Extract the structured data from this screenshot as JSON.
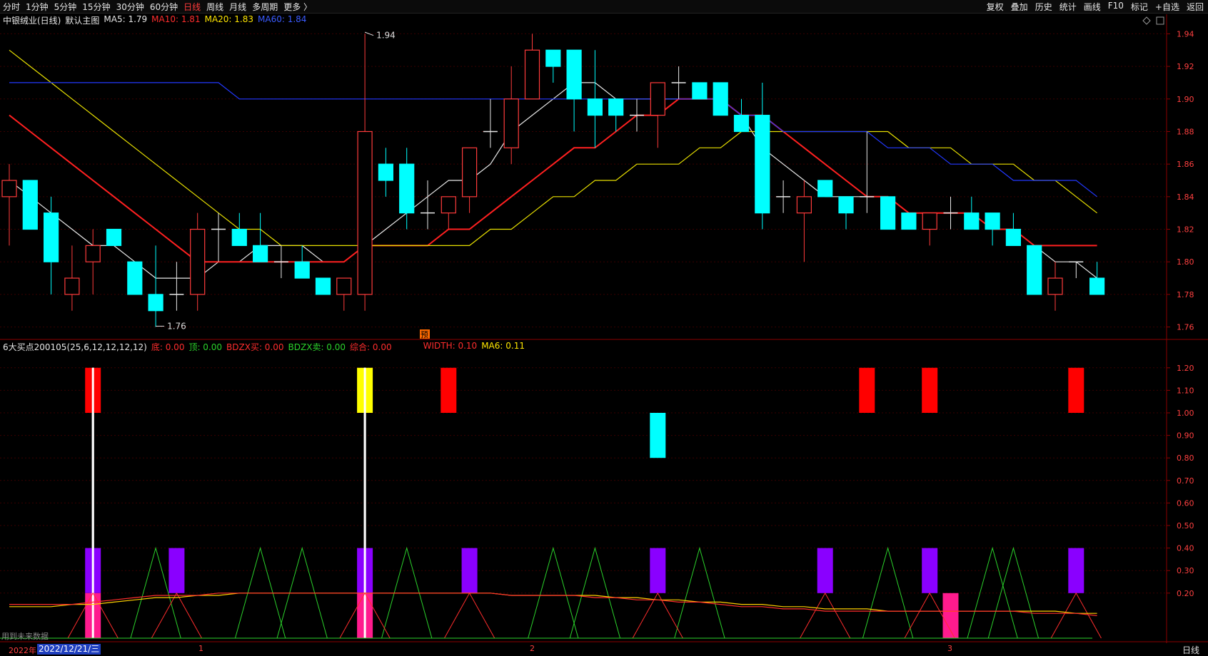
{
  "toolbar": {
    "left": [
      "分时",
      "1分钟",
      "5分钟",
      "15分钟",
      "30分钟",
      "60分钟",
      "日线",
      "周线",
      "月线",
      "多周期",
      "更多 〉"
    ],
    "active_index": 6,
    "right": [
      "复权",
      "叠加",
      "历史",
      "统计",
      "画线",
      "F10",
      "标记",
      "+自选",
      "返回"
    ]
  },
  "price_panel": {
    "stock_name": "中银绒业(日线)",
    "template": "默认主图",
    "ma5": "MA5: 1.79",
    "ma10": "MA10: 1.81",
    "ma20": "MA20: 1.83",
    "ma60": "MA60: 1.84",
    "high_marker": "1.94",
    "low_marker": "1.76",
    "axis": [
      "1.94",
      "1.92",
      "1.90",
      "1.88",
      "1.86",
      "1.84",
      "1.82",
      "1.80",
      "1.78",
      "1.76"
    ],
    "badge": "预"
  },
  "indicator_panel": {
    "name": "6大买点200105(25,6,12,12,12,12)",
    "di": "底: 0.00",
    "ding": "顶: 0.00",
    "bdzx_buy": "BDZX买: 0.00",
    "bdzx_sell": "BDZX卖: 0.00",
    "hehe": "综合: 0.00",
    "width": "WIDTH: 0.10",
    "ma6": "MA6: 0.11",
    "axis": [
      "1.20",
      "1.10",
      "1.00",
      "0.90",
      "0.80",
      "0.70",
      "0.60",
      "0.50",
      "0.40",
      "0.30",
      "0.20"
    ]
  },
  "footer": {
    "future_note": "用到未来数据",
    "year": "2022年",
    "date": "2022/12/21/三",
    "ticks": [
      "1",
      "2",
      "3"
    ],
    "period": "日线"
  },
  "chart_data": {
    "type": "candlestick",
    "candles": [
      {
        "o": 1.84,
        "h": 1.86,
        "l": 1.81,
        "c": 1.85
      },
      {
        "o": 1.85,
        "h": 1.85,
        "l": 1.82,
        "c": 1.82
      },
      {
        "o": 1.83,
        "h": 1.84,
        "l": 1.78,
        "c": 1.8
      },
      {
        "o": 1.78,
        "h": 1.81,
        "l": 1.77,
        "c": 1.79
      },
      {
        "o": 1.8,
        "h": 1.82,
        "l": 1.78,
        "c": 1.81
      },
      {
        "o": 1.82,
        "h": 1.82,
        "l": 1.81,
        "c": 1.81
      },
      {
        "o": 1.8,
        "h": 1.8,
        "l": 1.78,
        "c": 1.78
      },
      {
        "o": 1.78,
        "h": 1.81,
        "l": 1.76,
        "c": 1.77
      },
      {
        "o": 1.78,
        "h": 1.8,
        "l": 1.77,
        "c": 1.78
      },
      {
        "o": 1.78,
        "h": 1.83,
        "l": 1.77,
        "c": 1.82
      },
      {
        "o": 1.82,
        "h": 1.83,
        "l": 1.8,
        "c": 1.82
      },
      {
        "o": 1.82,
        "h": 1.83,
        "l": 1.81,
        "c": 1.81
      },
      {
        "o": 1.81,
        "h": 1.83,
        "l": 1.8,
        "c": 1.8
      },
      {
        "o": 1.8,
        "h": 1.81,
        "l": 1.79,
        "c": 1.8
      },
      {
        "o": 1.8,
        "h": 1.81,
        "l": 1.79,
        "c": 1.79
      },
      {
        "o": 1.79,
        "h": 1.79,
        "l": 1.78,
        "c": 1.78
      },
      {
        "o": 1.78,
        "h": 1.79,
        "l": 1.77,
        "c": 1.79
      },
      {
        "o": 1.78,
        "h": 1.94,
        "l": 1.77,
        "c": 1.88
      },
      {
        "o": 1.86,
        "h": 1.87,
        "l": 1.84,
        "c": 1.85
      },
      {
        "o": 1.86,
        "h": 1.87,
        "l": 1.82,
        "c": 1.83
      },
      {
        "o": 1.83,
        "h": 1.85,
        "l": 1.82,
        "c": 1.83
      },
      {
        "o": 1.83,
        "h": 1.84,
        "l": 1.82,
        "c": 1.84
      },
      {
        "o": 1.84,
        "h": 1.87,
        "l": 1.83,
        "c": 1.87
      },
      {
        "o": 1.88,
        "h": 1.9,
        "l": 1.87,
        "c": 1.88
      },
      {
        "o": 1.87,
        "h": 1.92,
        "l": 1.86,
        "c": 1.9
      },
      {
        "o": 1.9,
        "h": 1.94,
        "l": 1.9,
        "c": 1.93
      },
      {
        "o": 1.93,
        "h": 1.93,
        "l": 1.91,
        "c": 1.92
      },
      {
        "o": 1.93,
        "h": 1.93,
        "l": 1.88,
        "c": 1.9
      },
      {
        "o": 1.9,
        "h": 1.93,
        "l": 1.87,
        "c": 1.89
      },
      {
        "o": 1.9,
        "h": 1.9,
        "l": 1.88,
        "c": 1.89
      },
      {
        "o": 1.89,
        "h": 1.9,
        "l": 1.88,
        "c": 1.89
      },
      {
        "o": 1.89,
        "h": 1.91,
        "l": 1.87,
        "c": 1.91
      },
      {
        "o": 1.91,
        "h": 1.92,
        "l": 1.9,
        "c": 1.91
      },
      {
        "o": 1.91,
        "h": 1.91,
        "l": 1.9,
        "c": 1.9
      },
      {
        "o": 1.91,
        "h": 1.91,
        "l": 1.89,
        "c": 1.89
      },
      {
        "o": 1.89,
        "h": 1.9,
        "l": 1.88,
        "c": 1.88
      },
      {
        "o": 1.89,
        "h": 1.91,
        "l": 1.82,
        "c": 1.83
      },
      {
        "o": 1.84,
        "h": 1.85,
        "l": 1.83,
        "c": 1.84
      },
      {
        "o": 1.83,
        "h": 1.85,
        "l": 1.8,
        "c": 1.84
      },
      {
        "o": 1.85,
        "h": 1.85,
        "l": 1.84,
        "c": 1.84
      },
      {
        "o": 1.84,
        "h": 1.84,
        "l": 1.82,
        "c": 1.83
      },
      {
        "o": 1.84,
        "h": 1.88,
        "l": 1.83,
        "c": 1.84
      },
      {
        "o": 1.84,
        "h": 1.84,
        "l": 1.82,
        "c": 1.82
      },
      {
        "o": 1.83,
        "h": 1.83,
        "l": 1.82,
        "c": 1.82
      },
      {
        "o": 1.82,
        "h": 1.83,
        "l": 1.81,
        "c": 1.83
      },
      {
        "o": 1.83,
        "h": 1.84,
        "l": 1.82,
        "c": 1.83
      },
      {
        "o": 1.83,
        "h": 1.84,
        "l": 1.82,
        "c": 1.82
      },
      {
        "o": 1.83,
        "h": 1.83,
        "l": 1.81,
        "c": 1.82
      },
      {
        "o": 1.82,
        "h": 1.83,
        "l": 1.81,
        "c": 1.81
      },
      {
        "o": 1.81,
        "h": 1.81,
        "l": 1.78,
        "c": 1.78
      },
      {
        "o": 1.78,
        "h": 1.8,
        "l": 1.77,
        "c": 1.79
      },
      {
        "o": 1.8,
        "h": 1.8,
        "l": 1.79,
        "c": 1.8
      },
      {
        "o": 1.79,
        "h": 1.8,
        "l": 1.78,
        "c": 1.78
      }
    ],
    "ma_series": [
      {
        "name": "MA5",
        "color": "#e8e8e8",
        "values": [
          1.85,
          1.84,
          1.83,
          1.82,
          1.81,
          1.81,
          1.8,
          1.79,
          1.79,
          1.79,
          1.8,
          1.8,
          1.81,
          1.81,
          1.81,
          1.8,
          1.8,
          1.81,
          1.82,
          1.83,
          1.84,
          1.85,
          1.85,
          1.86,
          1.88,
          1.89,
          1.9,
          1.91,
          1.91,
          1.9,
          1.9,
          1.9,
          1.9,
          1.9,
          1.9,
          1.89,
          1.87,
          1.86,
          1.85,
          1.84,
          1.84,
          1.84,
          1.84,
          1.83,
          1.83,
          1.83,
          1.83,
          1.82,
          1.82,
          1.81,
          1.8,
          1.8,
          1.79
        ]
      },
      {
        "name": "MA10",
        "color": "#ff2020",
        "values": [
          1.89,
          1.88,
          1.87,
          1.86,
          1.85,
          1.84,
          1.83,
          1.82,
          1.81,
          1.8,
          1.8,
          1.8,
          1.8,
          1.8,
          1.8,
          1.8,
          1.8,
          1.81,
          1.81,
          1.81,
          1.81,
          1.82,
          1.82,
          1.83,
          1.84,
          1.85,
          1.86,
          1.87,
          1.87,
          1.88,
          1.89,
          1.89,
          1.9,
          1.9,
          1.9,
          1.89,
          1.89,
          1.88,
          1.87,
          1.86,
          1.85,
          1.84,
          1.84,
          1.83,
          1.83,
          1.83,
          1.83,
          1.82,
          1.82,
          1.81,
          1.81,
          1.81,
          1.81
        ]
      },
      {
        "name": "MA20",
        "color": "#e8e000",
        "values": [
          1.93,
          1.92,
          1.91,
          1.9,
          1.89,
          1.88,
          1.87,
          1.86,
          1.85,
          1.84,
          1.83,
          1.82,
          1.82,
          1.81,
          1.81,
          1.81,
          1.81,
          1.81,
          1.81,
          1.81,
          1.81,
          1.81,
          1.81,
          1.82,
          1.82,
          1.83,
          1.84,
          1.84,
          1.85,
          1.85,
          1.86,
          1.86,
          1.86,
          1.87,
          1.87,
          1.88,
          1.88,
          1.88,
          1.88,
          1.88,
          1.88,
          1.88,
          1.88,
          1.87,
          1.87,
          1.87,
          1.86,
          1.86,
          1.86,
          1.85,
          1.85,
          1.84,
          1.83
        ]
      },
      {
        "name": "MA60",
        "color": "#2238ff",
        "values": [
          1.91,
          1.91,
          1.91,
          1.91,
          1.91,
          1.91,
          1.91,
          1.91,
          1.91,
          1.91,
          1.91,
          1.9,
          1.9,
          1.9,
          1.9,
          1.9,
          1.9,
          1.9,
          1.9,
          1.9,
          1.9,
          1.9,
          1.9,
          1.9,
          1.9,
          1.9,
          1.9,
          1.9,
          1.9,
          1.9,
          1.9,
          1.9,
          1.9,
          1.9,
          1.9,
          1.89,
          1.89,
          1.88,
          1.88,
          1.88,
          1.88,
          1.88,
          1.87,
          1.87,
          1.87,
          1.86,
          1.86,
          1.86,
          1.85,
          1.85,
          1.85,
          1.85,
          1.84
        ]
      }
    ],
    "indicator": {
      "red_bars": [
        4,
        21,
        41,
        44,
        51
      ],
      "yellow_bars": [
        17
      ],
      "cyan_bars": [
        31
      ],
      "purple_bars": [
        4,
        8,
        17,
        22,
        31,
        39,
        44,
        51
      ],
      "pink_bars": [
        4,
        17,
        45
      ],
      "white_lines": [
        4,
        17
      ],
      "green_peaks": [
        7,
        12,
        14,
        19,
        26,
        28,
        33,
        42,
        47,
        48
      ],
      "red_peaks": [
        4,
        8,
        17,
        22,
        31,
        39,
        44,
        51
      ]
    }
  }
}
